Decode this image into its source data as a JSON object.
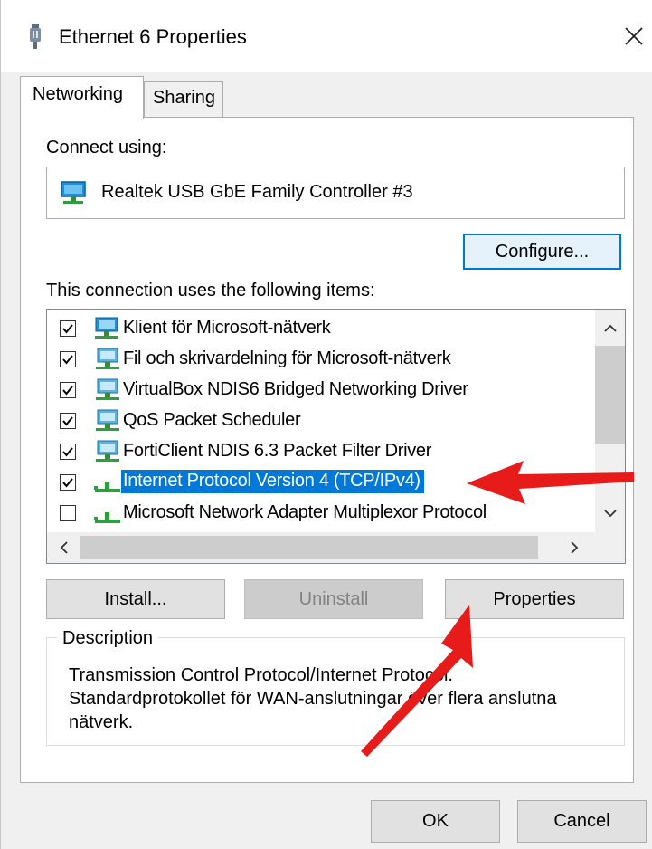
{
  "window": {
    "title": "Ethernet 6 Properties",
    "close_glyph": "✕"
  },
  "tabs": [
    {
      "label": "Networking",
      "active": true
    },
    {
      "label": "Sharing",
      "active": false
    }
  ],
  "connect_using": {
    "label": "Connect using:",
    "adapter": "Realtek USB GbE Family Controller #3",
    "configure_label": "Configure..."
  },
  "items": {
    "label": "This connection uses the following items:",
    "rows": [
      {
        "label": "Klient för Microsoft-nätverk",
        "checked": true,
        "icon": "network-client-icon"
      },
      {
        "label": "Fil och skrivardelning för Microsoft-nätverk",
        "checked": true,
        "icon": "network-service-icon"
      },
      {
        "label": "VirtualBox NDIS6 Bridged Networking Driver",
        "checked": true,
        "icon": "network-service-icon"
      },
      {
        "label": "QoS Packet Scheduler",
        "checked": true,
        "icon": "network-service-icon"
      },
      {
        "label": "FortiClient NDIS 6.3 Packet Filter Driver",
        "checked": true,
        "icon": "network-service-icon"
      },
      {
        "label": "Internet Protocol Version 4 (TCP/IPv4)",
        "checked": true,
        "icon": "protocol-icon",
        "selected": true
      },
      {
        "label": "Microsoft Network Adapter Multiplexor Protocol",
        "checked": false,
        "icon": "protocol-icon"
      }
    ]
  },
  "buttons": {
    "install": "Install...",
    "uninstall": "Uninstall",
    "properties": "Properties",
    "ok": "OK",
    "cancel": "Cancel"
  },
  "description": {
    "title": "Description",
    "text": "Transmission Control Protocol/Internet Protocol. Standardprotokollet för WAN-anslutningar över flera anslutna nätverk."
  },
  "colors": {
    "selection": "#0078d7",
    "annotation_arrow": "#e81b1b"
  }
}
